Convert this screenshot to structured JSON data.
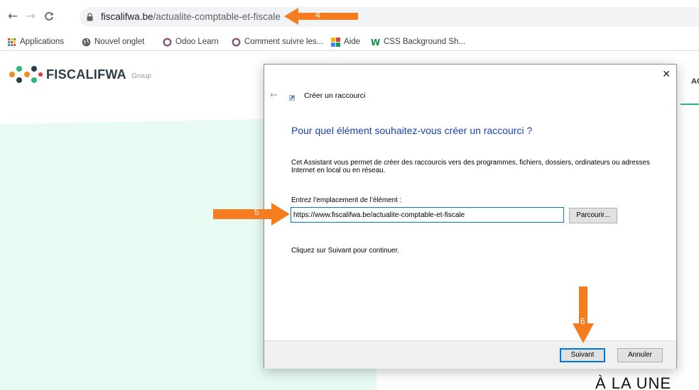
{
  "browser": {
    "back_icon": "arrow-left-icon",
    "forward_icon": "arrow-right-icon",
    "reload_icon": "reload-icon",
    "url_domain": "fiscalifwa.be",
    "url_path": "/actualite-comptable-et-fiscale"
  },
  "bookmarks": [
    {
      "label": "Applications",
      "icon": "apps-grid-icon"
    },
    {
      "label": "Nouvel onglet",
      "icon": "globe-icon"
    },
    {
      "label": "Odoo Learn",
      "icon": "odoo-icon"
    },
    {
      "label": "Comment suivre les...",
      "icon": "odoo-icon"
    },
    {
      "label": "Aide",
      "icon": "aide-icon"
    },
    {
      "label": "CSS Background Sh...",
      "icon": "w-icon"
    }
  ],
  "page": {
    "logo_text": "FISCALIFWA",
    "logo_sub": "Group",
    "nav_partial": "AC",
    "bottom_text": "À LA UNE"
  },
  "dialog": {
    "close_label": "✕",
    "back_label": "←",
    "title": "Créer un raccourci",
    "heading": "Pour quel élément souhaitez-vous créer un raccourci ?",
    "description": "Cet Assistant vous permet de créer des raccourcis vers des programmes, fichiers, dossiers, ordinateurs ou adresses Internet en local ou en réseau.",
    "field_label": "Entrez l’emplacement de l’élément :",
    "field_value": "https://www.fiscalifwa.be/actualite-comptable-et-fiscale",
    "browse_label": "Parcourir...",
    "hint": "Cliquez sur Suivant pour continuer.",
    "next_label": "Suivant",
    "cancel_label": "Annuler"
  },
  "annotations": {
    "step4": "4",
    "step5": "5",
    "step6": "6",
    "arrow_color": "#f57c1f"
  },
  "colors": {
    "heading_blue": "#1a3fa8",
    "focus_blue": "#0078d7",
    "mint": "#e8fbf2"
  }
}
